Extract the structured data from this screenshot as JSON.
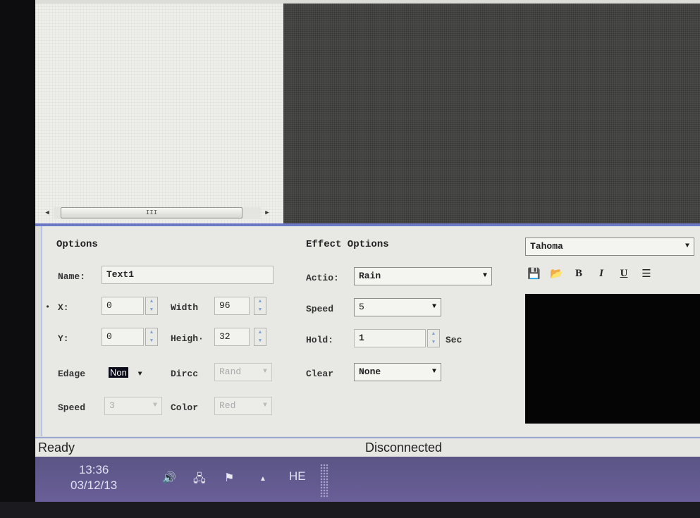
{
  "panel": {
    "options": {
      "title": "Options",
      "name_label": "Name:",
      "name_value": "Text1",
      "x_label": "X:",
      "x_value": "0",
      "width_label": "Width",
      "width_value": "96",
      "y_label": "Y:",
      "y_value": "0",
      "height_label": "Heigh·",
      "height_value": "32",
      "edge_label": "Edage",
      "edge_value": "Non",
      "direction_label": "Dircc",
      "direction_value": "Rand",
      "speed_label": "Speed",
      "speed_value": "3",
      "color_label": "Color",
      "color_value": "Red"
    },
    "effect": {
      "title": "Effect Options",
      "action_label": "Actio:",
      "action_value": "Rain",
      "speed_label": "Speed",
      "speed_value": "5",
      "hold_label": "Hold:",
      "hold_value": "1",
      "hold_unit": "Sec",
      "clear_label": "Clear",
      "clear_value": "None"
    },
    "text": {
      "font_value": "Tahoma",
      "bold": "B",
      "italic": "I",
      "underline": "U",
      "icons": [
        "save-icon",
        "open-folder-icon",
        "align-icon"
      ]
    }
  },
  "scrollbar": {
    "thumb_grip": "III"
  },
  "status": {
    "left": "Ready",
    "connection": "Disconnected"
  },
  "taskbar": {
    "time": "13:36",
    "date": "03/12/13",
    "language": "HE"
  },
  "colors": {
    "splitter": "#6a78c8",
    "taskbar": "#5f5890",
    "editor_bg": "#050505"
  }
}
